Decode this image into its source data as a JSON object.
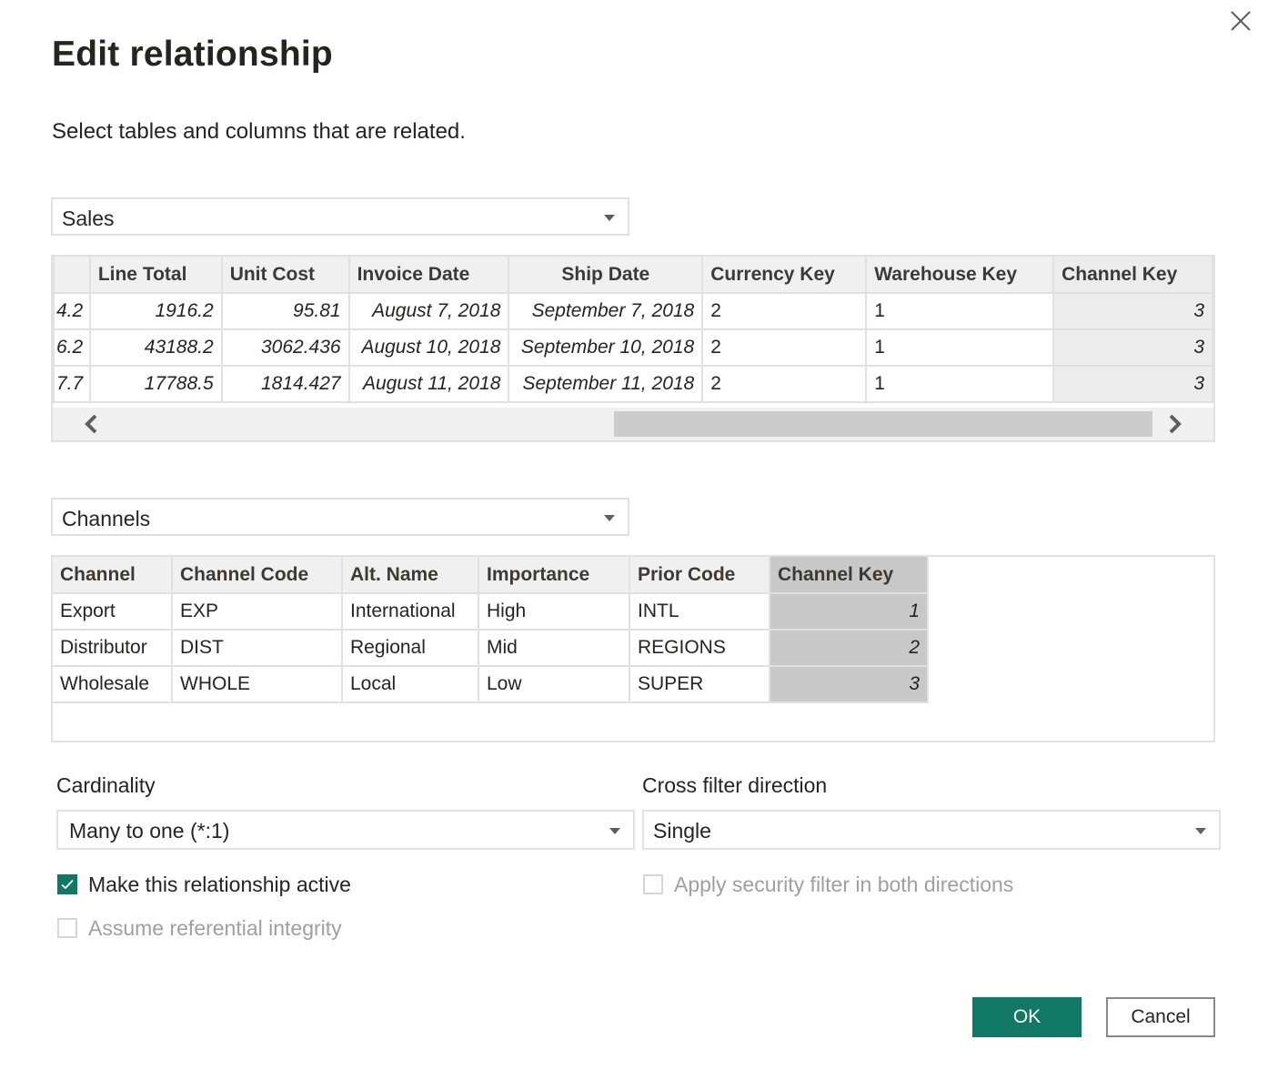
{
  "dialog": {
    "title": "Edit relationship",
    "subtitle": "Select tables and columns that are related.",
    "close_icon": "close-icon"
  },
  "table1": {
    "selected": "Sales",
    "columns": [
      "",
      "Line Total",
      "Unit Cost",
      "Invoice Date",
      "Ship Date",
      "Currency Key",
      "Warehouse Key",
      "Channel Key"
    ],
    "rows": [
      [
        "4.2",
        "1916.2",
        "95.81",
        "August 7, 2018",
        "September 7, 2018",
        "2",
        "1",
        "3"
      ],
      [
        "6.2",
        "43188.2",
        "3062.436",
        "August 10, 2018",
        "September 10, 2018",
        "2",
        "1",
        "3"
      ],
      [
        "7.7",
        "17788.5",
        "1814.427",
        "August 11, 2018",
        "September 11, 2018",
        "2",
        "1",
        "3"
      ]
    ],
    "selected_column": "Channel Key",
    "scroll_left_icon": "chevron-left-icon",
    "scroll_right_icon": "chevron-right-icon"
  },
  "table2": {
    "selected": "Channels",
    "columns": [
      "Channel",
      "Channel Code",
      "Alt. Name",
      "Importance",
      "Prior Code",
      "Channel Key"
    ],
    "rows": [
      [
        "Export",
        "EXP",
        "International",
        "High",
        "INTL",
        "1"
      ],
      [
        "Distributor",
        "DIST",
        "Regional",
        "Mid",
        "REGIONS",
        "2"
      ],
      [
        "Wholesale",
        "WHOLE",
        "Local",
        "Low",
        "SUPER",
        "3"
      ]
    ],
    "selected_column": "Channel Key"
  },
  "cardinality": {
    "label": "Cardinality",
    "value": "Many to one (*:1)"
  },
  "cross_filter": {
    "label": "Cross filter direction",
    "value": "Single"
  },
  "options": {
    "make_active": {
      "label": "Make this relationship active",
      "checked": true,
      "enabled": true
    },
    "referential_integrity": {
      "label": "Assume referential integrity",
      "checked": false,
      "enabled": false
    },
    "security_filter": {
      "label": "Apply security filter in both directions",
      "checked": false,
      "enabled": false
    }
  },
  "buttons": {
    "ok": "OK",
    "cancel": "Cancel"
  },
  "colors": {
    "accent": "#117865",
    "selected_column_light": "#ececec",
    "selected_column_dark": "#c8c8c8"
  }
}
